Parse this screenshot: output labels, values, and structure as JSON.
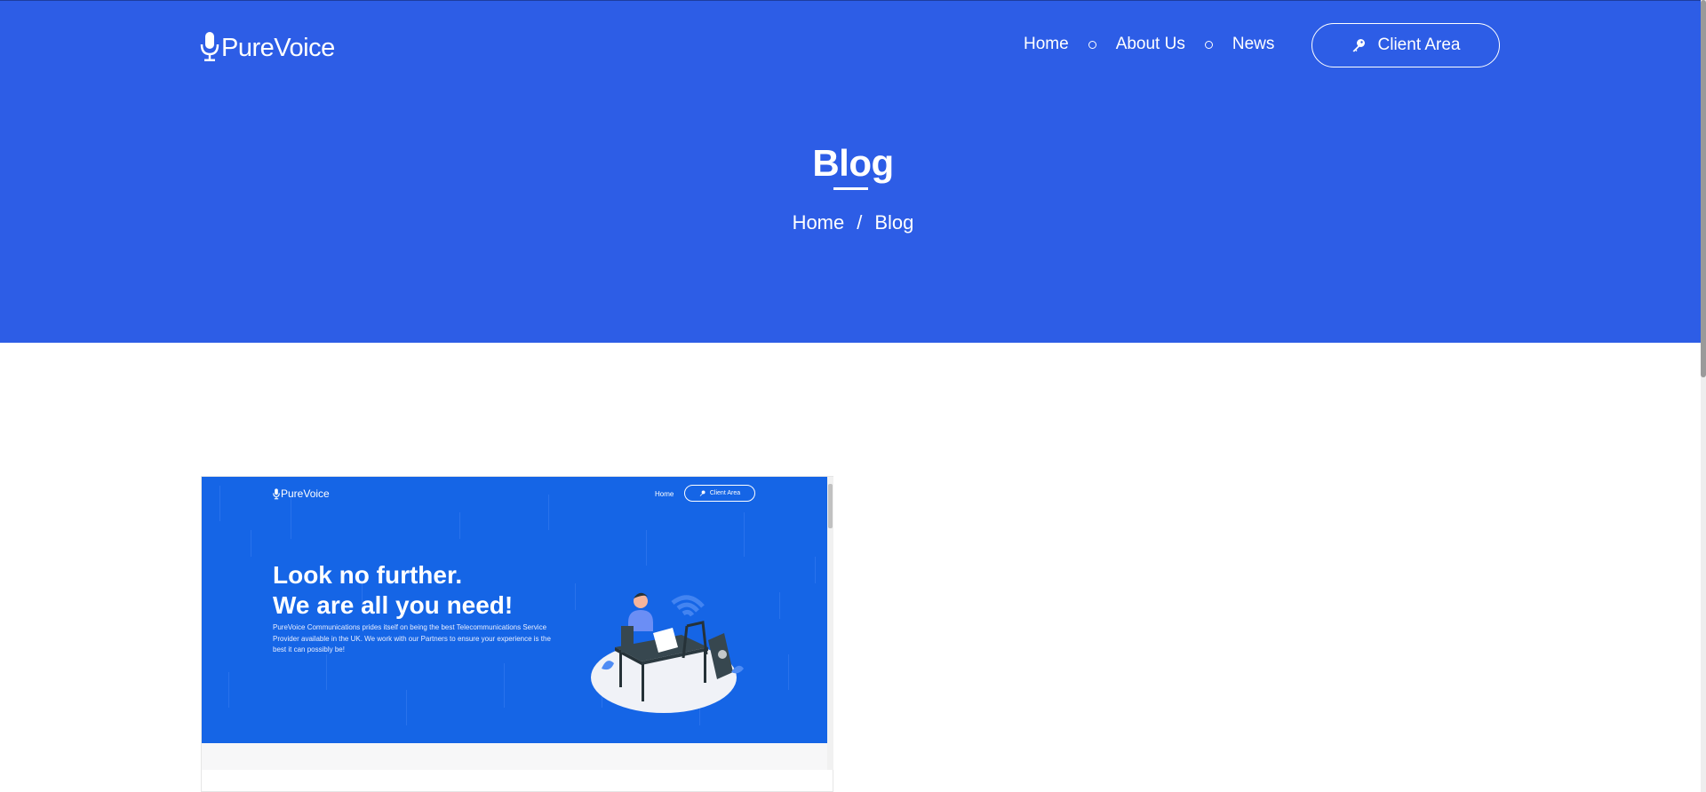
{
  "header": {
    "logo_text": "PureVoice",
    "nav": [
      "Home",
      "About Us",
      "News"
    ],
    "client_button": "Client Area"
  },
  "hero": {
    "title": "Blog",
    "breadcrumb": [
      "Home",
      "Blog"
    ],
    "breadcrumb_separator": "/"
  },
  "post": {
    "thumbnail": {
      "logo_text": "PureVoice",
      "nav_home": "Home",
      "client_button": "Client Area",
      "headline_line1": "Look no further.",
      "headline_line2": "We are all you need!",
      "body": "PureVoice Communications prides itself on being the best Telecommunications Service Provider available in the UK. We work with our Partners to ensure your experience is the best it can possibly be!"
    }
  },
  "colors": {
    "hero_bg": "#2d5de6",
    "thumb_bg": "#1565e6",
    "text": "#ffffff"
  },
  "icons": {
    "logo": "microphone-icon",
    "client": "key-icon"
  }
}
